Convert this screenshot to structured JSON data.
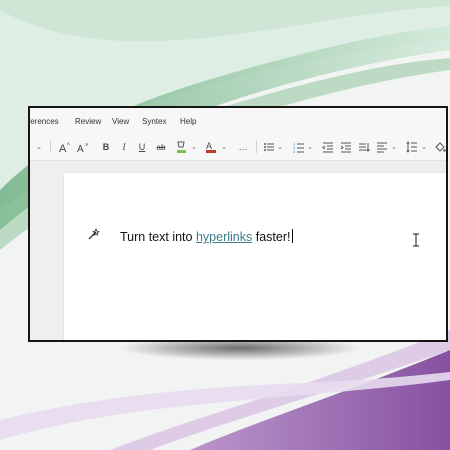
{
  "menu": {
    "items": [
      "ferences",
      "Review",
      "View",
      "Syntex",
      "Help"
    ]
  },
  "toolbar": {
    "font_size_chevron": "⌄",
    "grow_font": "A^",
    "shrink_font": "A˅",
    "bold": "B",
    "italic": "I",
    "underline": "U",
    "strike": "ab",
    "more": "…"
  },
  "document": {
    "text_before": "Turn text into ",
    "link_text": "hyperlinks",
    "text_after": " faster!"
  },
  "colors": {
    "link": "#3c7c86",
    "font_color_swatch": "#c0392b",
    "highlight_swatch": "#7fbf4d"
  }
}
